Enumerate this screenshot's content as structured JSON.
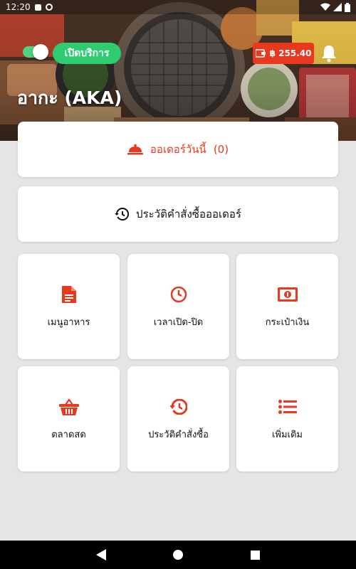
{
  "status_bar": {
    "time": "12:20"
  },
  "header": {
    "service_toggle_on": true,
    "open_service_label": "เปิดบริการ",
    "wallet_amount": "฿ 255.40",
    "shop_name": "อากะ (AKA)"
  },
  "today_orders": {
    "label": "ออเดอร์วันนี้",
    "count": "(0)"
  },
  "order_history": {
    "label": "ประวัติคำสั่งซื้อออเดอร์"
  },
  "menu_tiles": [
    {
      "label": "เมนูอาหาร",
      "icon": "document-icon"
    },
    {
      "label": "เวลาเปิด-ปิด",
      "icon": "clock-icon"
    },
    {
      "label": "กระเป๋าเงิน",
      "icon": "money-icon"
    },
    {
      "label": "ตลาดสด",
      "icon": "basket-icon"
    },
    {
      "label": "ประวัติคำสั่งซื้อ",
      "icon": "history-icon"
    },
    {
      "label": "เพิ่มเติม",
      "icon": "list-icon"
    }
  ],
  "colors": {
    "accent": "#e8391f",
    "open_green": "#2ecc71",
    "background": "#e5e5e5"
  }
}
